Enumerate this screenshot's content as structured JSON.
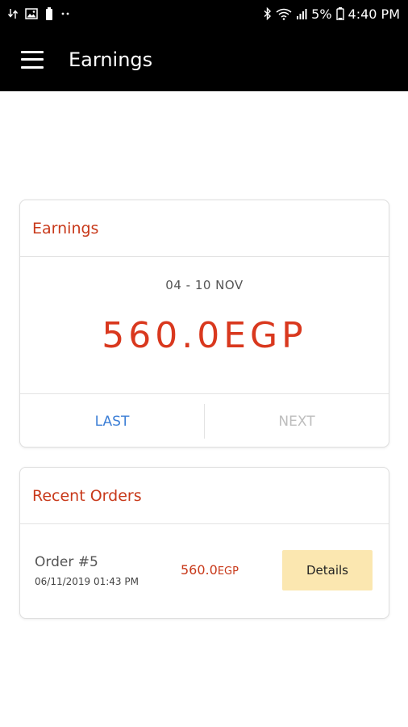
{
  "status_bar": {
    "battery_percent": "5%",
    "time": "4:40 PM"
  },
  "app_bar": {
    "title": "Earnings"
  },
  "earnings_card": {
    "title": "Earnings",
    "week_range": "04 - 10 NOV",
    "amount": "560.0EGP",
    "last_label": "LAST",
    "next_label": "NEXT"
  },
  "orders_card": {
    "title": "Recent Orders",
    "orders": [
      {
        "number": "Order #5",
        "date": "06/11/2019 01:43 PM",
        "amount": "560.0",
        "currency": "EGP",
        "details_label": "Details"
      }
    ]
  },
  "colors": {
    "accent": "#c8391a",
    "amount": "#d9381e",
    "link_blue": "#3d7fd6",
    "disabled_gray": "#bdbdbd",
    "details_bg": "#fbe7b0"
  }
}
